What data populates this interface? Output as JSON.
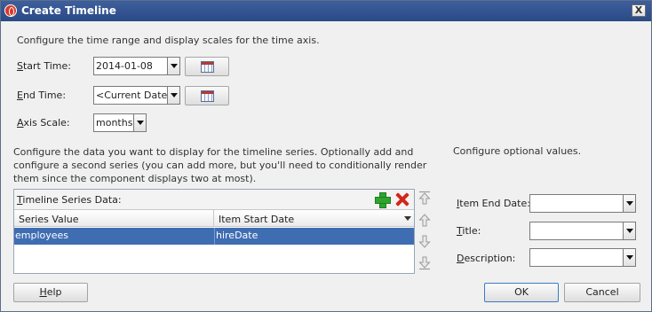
{
  "window": {
    "title": "Create Timeline",
    "close_label": "X"
  },
  "intro": "Configure the time range and display scales for the time axis.",
  "time_axis": {
    "start_label": "Start Time:",
    "start_mnemonic": "S",
    "start_rest": "tart Time:",
    "start_value": "2014-01-08",
    "end_mnemonic": "E",
    "end_rest": "nd Time:",
    "end_value": "<Current Date>",
    "axis_mnemonic": "A",
    "axis_rest": "xis Scale:",
    "axis_value": "months"
  },
  "series_section": {
    "description": "Configure the data you want to display for the timeline series. Optionally add and configure a second series (you can add more, but you'll need to conditionally render them since the component displays two at most).",
    "panel_mnemonic": "T",
    "panel_rest": "imeline Series Data:",
    "columns": [
      "Series Value",
      "Item Start Date"
    ],
    "rows": [
      {
        "series_value": "employees",
        "item_start_date": "hireDate"
      }
    ]
  },
  "optional": {
    "title": "Configure optional values.",
    "item_end_mnemonic": "I",
    "item_end_rest": "tem End Date:",
    "title_mnemonic": "T",
    "title_rest": "itle:",
    "description_mnemonic": "D",
    "description_rest": "escription:"
  },
  "buttons": {
    "help_mnemonic": "H",
    "help_rest": "elp",
    "ok": "OK",
    "cancel": "Cancel"
  },
  "colors": {
    "selection": "#3f6db2",
    "titlebar": "#2a4a86"
  }
}
